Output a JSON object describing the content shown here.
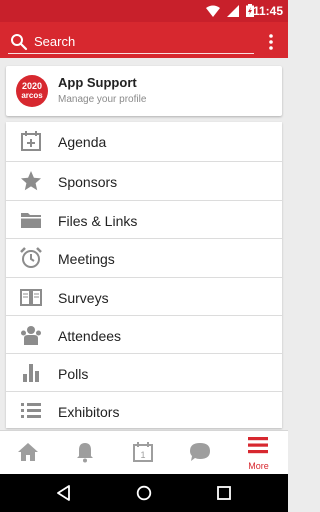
{
  "status_bar": {
    "time": "11:45",
    "icons": [
      "wifi-icon",
      "signal-icon",
      "battery-charging-icon"
    ],
    "color": "#c8202b"
  },
  "app_bar": {
    "search_label": "Search",
    "icons": [
      "search-icon",
      "overflow-menu-icon"
    ],
    "color": "#d7282f"
  },
  "profile": {
    "logo_year": "2020",
    "logo_name": "arcos",
    "title": "App Support",
    "subtitle": "Manage your profile"
  },
  "menu": {
    "items": [
      {
        "label": "Agenda",
        "icon": "calendar-plus-icon"
      },
      {
        "label": "Sponsors",
        "icon": "star-icon"
      },
      {
        "label": "Files & Links",
        "icon": "folder-icon"
      },
      {
        "label": "Meetings",
        "icon": "alarm-clock-icon"
      },
      {
        "label": "Surveys",
        "icon": "open-book-icon"
      },
      {
        "label": "Attendees",
        "icon": "people-icon"
      },
      {
        "label": "Polls",
        "icon": "bar-chart-icon"
      },
      {
        "label": "Exhibitors",
        "icon": "list-icon"
      }
    ],
    "icon_color": "#8c8c8c"
  },
  "bottom_nav": {
    "items": [
      {
        "icon": "home-icon"
      },
      {
        "icon": "bell-icon"
      },
      {
        "icon": "calendar-icon",
        "date": "1"
      },
      {
        "icon": "chat-bubble-icon"
      },
      {
        "icon": "hamburger-menu-icon",
        "label": "More",
        "active": true
      }
    ],
    "active_color": "#d7282f",
    "inactive_color": "#9e9e9e"
  },
  "system_nav": {
    "icons": [
      "back-icon",
      "home-circle-icon",
      "recents-icon"
    ]
  }
}
